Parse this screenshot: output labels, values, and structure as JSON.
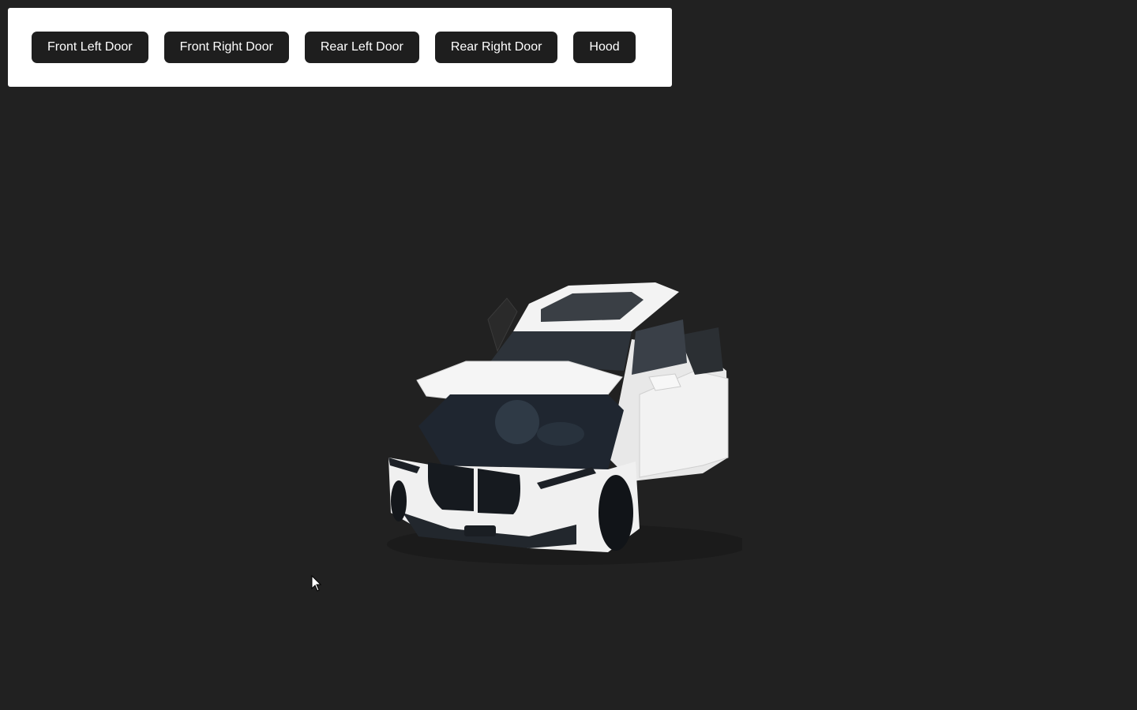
{
  "toolbar": {
    "buttons": [
      {
        "label": "Front Left Door"
      },
      {
        "label": "Front Right Door"
      },
      {
        "label": "Rear Left Door"
      },
      {
        "label": "Rear Right Door"
      },
      {
        "label": "Hood"
      }
    ]
  },
  "scene": {
    "background_color": "#212121",
    "panel_color": "#ffffff",
    "button_color": "#1e1e1e",
    "car_body_color": "#eeeeee",
    "model_icon": "car-icon"
  }
}
